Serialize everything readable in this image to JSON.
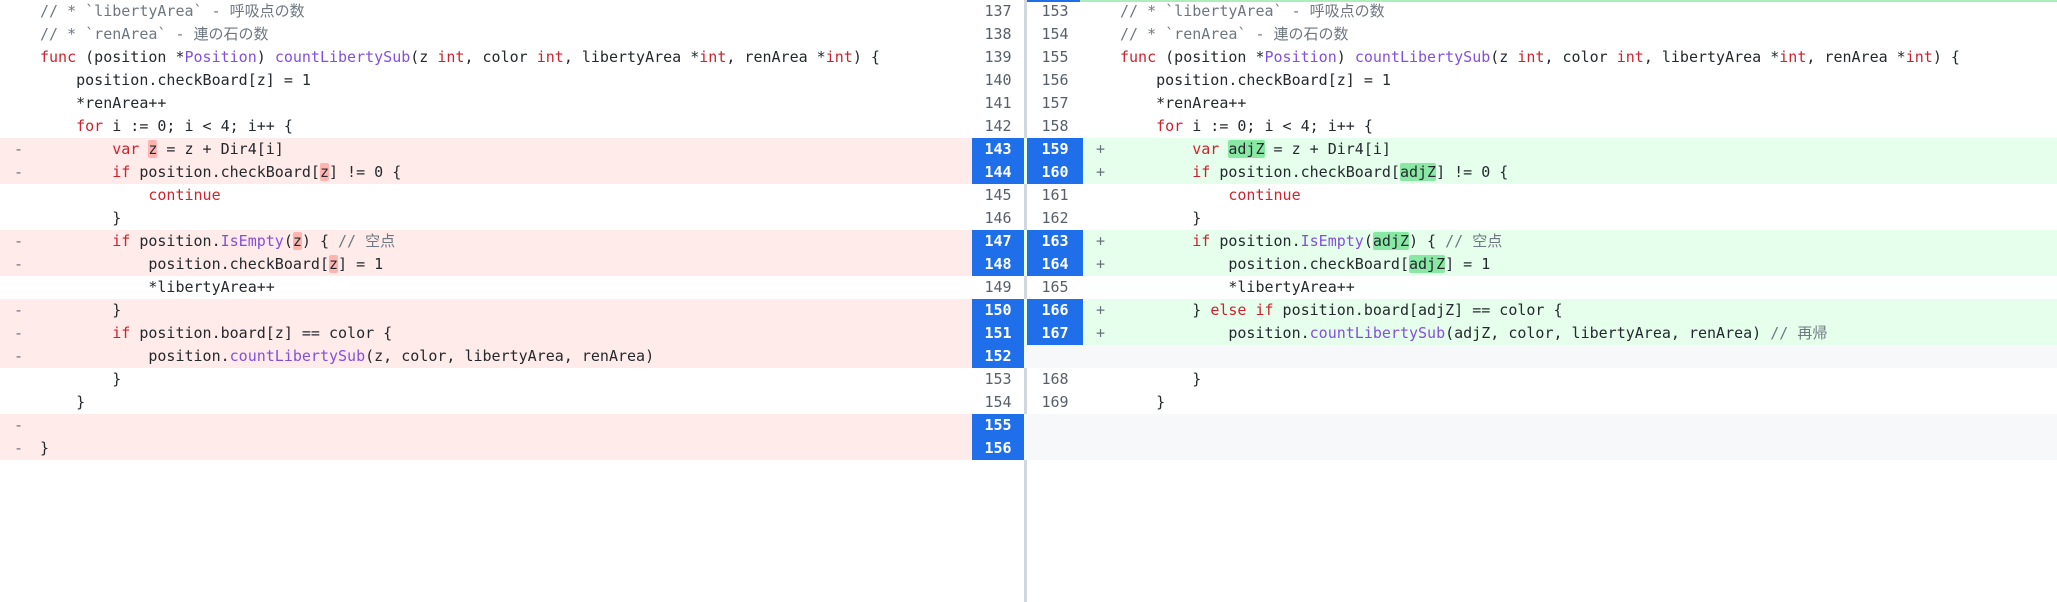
{
  "left": {
    "rows": [
      {
        "kind": "ctx",
        "num": "137",
        "sign": "",
        "indent": 0,
        "tokens": [
          [
            "cm",
            "// * `libertyArea` - 呼吸点の数"
          ]
        ]
      },
      {
        "kind": "ctx",
        "num": "138",
        "sign": "",
        "indent": 0,
        "tokens": [
          [
            "cm",
            "// * `renArea` - 連の石の数"
          ]
        ]
      },
      {
        "kind": "ctx",
        "num": "139",
        "sign": "",
        "indent": 0,
        "tokens": [
          [
            "kw",
            "func"
          ],
          [
            "",
            " (position *"
          ],
          [
            "fn",
            "Position"
          ],
          [
            "",
            ") "
          ],
          [
            "fn",
            "countLibertySub"
          ],
          [
            "",
            "(z "
          ],
          [
            "ty",
            "int"
          ],
          [
            "",
            ", color "
          ],
          [
            "ty",
            "int"
          ],
          [
            "",
            ", libertyArea *"
          ],
          [
            "ty",
            "int"
          ],
          [
            "",
            ", renArea *"
          ],
          [
            "ty",
            "int"
          ],
          [
            "",
            ") {"
          ]
        ]
      },
      {
        "kind": "ctx",
        "num": "140",
        "sign": "",
        "indent": 1,
        "tokens": [
          [
            "",
            "position.checkBoard[z] = 1"
          ]
        ]
      },
      {
        "kind": "ctx",
        "num": "141",
        "sign": "",
        "indent": 1,
        "tokens": [
          [
            "",
            "*renArea++"
          ]
        ]
      },
      {
        "kind": "ctx",
        "num": "142",
        "sign": "",
        "indent": 1,
        "tokens": [
          [
            "kw",
            "for"
          ],
          [
            "",
            " i := 0; i < 4; i++ {"
          ]
        ]
      },
      {
        "kind": "del",
        "num": "143",
        "sign": "-",
        "indent": 2,
        "tokens": [
          [
            "kw",
            "var"
          ],
          [
            "",
            " "
          ],
          [
            "hl-del",
            "z"
          ],
          [
            "",
            " = z + Dir4[i]"
          ]
        ]
      },
      {
        "kind": "del",
        "num": "144",
        "sign": "-",
        "indent": 2,
        "tokens": [
          [
            "kw",
            "if"
          ],
          [
            "",
            " position.checkBoard["
          ],
          [
            "hl-del",
            "z"
          ],
          [
            "",
            "] != 0 {"
          ]
        ]
      },
      {
        "kind": "ctx",
        "num": "145",
        "sign": "",
        "indent": 3,
        "tokens": [
          [
            "kw",
            "continue"
          ]
        ]
      },
      {
        "kind": "ctx",
        "num": "146",
        "sign": "",
        "indent": 2,
        "tokens": [
          [
            "",
            "}"
          ]
        ]
      },
      {
        "kind": "del",
        "num": "147",
        "sign": "-",
        "indent": 2,
        "tokens": [
          [
            "kw",
            "if"
          ],
          [
            "",
            " position."
          ],
          [
            "fn",
            "IsEmpty"
          ],
          [
            "",
            "("
          ],
          [
            "hl-del",
            "z"
          ],
          [
            "",
            ") { "
          ],
          [
            "cm",
            "// 空点"
          ]
        ]
      },
      {
        "kind": "del",
        "num": "148",
        "sign": "-",
        "indent": 3,
        "tokens": [
          [
            "",
            "position.checkBoard["
          ],
          [
            "hl-del",
            "z"
          ],
          [
            "",
            "] = 1"
          ]
        ]
      },
      {
        "kind": "ctx",
        "num": "149",
        "sign": "",
        "indent": 3,
        "tokens": [
          [
            "",
            "*libertyArea++"
          ]
        ]
      },
      {
        "kind": "del",
        "num": "150",
        "sign": "-",
        "indent": 2,
        "tokens": [
          [
            "",
            "}"
          ]
        ]
      },
      {
        "kind": "del",
        "num": "151",
        "sign": "-",
        "indent": 2,
        "tokens": [
          [
            "kw",
            "if"
          ],
          [
            "",
            " position.board[z] == color {"
          ]
        ]
      },
      {
        "kind": "del",
        "num": "152",
        "sign": "-",
        "indent": 3,
        "tokens": [
          [
            "",
            "position."
          ],
          [
            "fn",
            "countLibertySub"
          ],
          [
            "",
            "(z, color, libertyArea, renArea)"
          ]
        ]
      },
      {
        "kind": "ctx",
        "num": "153",
        "sign": "",
        "indent": 2,
        "tokens": [
          [
            "",
            "}"
          ]
        ]
      },
      {
        "kind": "ctx",
        "num": "154",
        "sign": "",
        "indent": 1,
        "tokens": [
          [
            "",
            "}"
          ]
        ]
      },
      {
        "kind": "del",
        "num": "155",
        "sign": "-",
        "indent": 0,
        "tokens": []
      },
      {
        "kind": "del",
        "num": "156",
        "sign": "-",
        "indent": 0,
        "tokens": [
          [
            "",
            "}"
          ]
        ]
      }
    ]
  },
  "right": {
    "rows": [
      {
        "kind": "ctx",
        "num": "153",
        "sign": "",
        "indent": 0,
        "tokens": [
          [
            "cm",
            "// * `libertyArea` - 呼吸点の数"
          ]
        ]
      },
      {
        "kind": "ctx",
        "num": "154",
        "sign": "",
        "indent": 0,
        "tokens": [
          [
            "cm",
            "// * `renArea` - 連の石の数"
          ]
        ]
      },
      {
        "kind": "ctx",
        "num": "155",
        "sign": "",
        "indent": 0,
        "tokens": [
          [
            "kw",
            "func"
          ],
          [
            "",
            " (position *"
          ],
          [
            "fn",
            "Position"
          ],
          [
            "",
            ") "
          ],
          [
            "fn",
            "countLibertySub"
          ],
          [
            "",
            "(z "
          ],
          [
            "ty",
            "int"
          ],
          [
            "",
            ", color "
          ],
          [
            "ty",
            "int"
          ],
          [
            "",
            ", libertyArea *"
          ],
          [
            "ty",
            "int"
          ],
          [
            "",
            ", renArea *"
          ],
          [
            "ty",
            "int"
          ],
          [
            "",
            ") {"
          ]
        ]
      },
      {
        "kind": "ctx",
        "num": "156",
        "sign": "",
        "indent": 1,
        "tokens": [
          [
            "",
            "position.checkBoard[z] = 1"
          ]
        ]
      },
      {
        "kind": "ctx",
        "num": "157",
        "sign": "",
        "indent": 1,
        "tokens": [
          [
            "",
            "*renArea++"
          ]
        ]
      },
      {
        "kind": "ctx",
        "num": "158",
        "sign": "",
        "indent": 1,
        "tokens": [
          [
            "kw",
            "for"
          ],
          [
            "",
            " i := 0; i < 4; i++ {"
          ]
        ]
      },
      {
        "kind": "add",
        "num": "159",
        "sign": "+",
        "indent": 2,
        "tokens": [
          [
            "kw",
            "var"
          ],
          [
            "",
            " "
          ],
          [
            "hl-add",
            "adjZ"
          ],
          [
            "",
            " = z + Dir4[i]"
          ]
        ]
      },
      {
        "kind": "add",
        "num": "160",
        "sign": "+",
        "indent": 2,
        "tokens": [
          [
            "kw",
            "if"
          ],
          [
            "",
            " position.checkBoard["
          ],
          [
            "hl-add",
            "adjZ"
          ],
          [
            "",
            "] != 0 {"
          ]
        ]
      },
      {
        "kind": "ctx",
        "num": "161",
        "sign": "",
        "indent": 3,
        "tokens": [
          [
            "kw",
            "continue"
          ]
        ]
      },
      {
        "kind": "ctx",
        "num": "162",
        "sign": "",
        "indent": 2,
        "tokens": [
          [
            "",
            "}"
          ]
        ]
      },
      {
        "kind": "add",
        "num": "163",
        "sign": "+",
        "indent": 2,
        "tokens": [
          [
            "kw",
            "if"
          ],
          [
            "",
            " position."
          ],
          [
            "fn",
            "IsEmpty"
          ],
          [
            "",
            "("
          ],
          [
            "hl-add",
            "adjZ"
          ],
          [
            "",
            ") { "
          ],
          [
            "cm",
            "// 空点"
          ]
        ]
      },
      {
        "kind": "add",
        "num": "164",
        "sign": "+",
        "indent": 3,
        "tokens": [
          [
            "",
            "position.checkBoard["
          ],
          [
            "hl-add",
            "adjZ"
          ],
          [
            "",
            "] = 1"
          ]
        ]
      },
      {
        "kind": "ctx",
        "num": "165",
        "sign": "",
        "indent": 3,
        "tokens": [
          [
            "",
            "*libertyArea++"
          ]
        ]
      },
      {
        "kind": "add",
        "num": "166",
        "sign": "+",
        "indent": 2,
        "tokens": [
          [
            "",
            "} "
          ],
          [
            "kw",
            "else if"
          ],
          [
            "",
            " position.board[adjZ] == color {"
          ]
        ]
      },
      {
        "kind": "add",
        "num": "167",
        "sign": "+",
        "indent": 3,
        "tokens": [
          [
            "",
            "position."
          ],
          [
            "fn",
            "countLibertySub"
          ],
          [
            "",
            "(adjZ, color, libertyArea, renArea) "
          ],
          [
            "cm",
            "// 再帰"
          ]
        ]
      },
      {
        "kind": "empty",
        "num": "",
        "sign": "",
        "indent": 0,
        "tokens": []
      },
      {
        "kind": "ctx",
        "num": "168",
        "sign": "",
        "indent": 2,
        "tokens": [
          [
            "",
            "}"
          ]
        ]
      },
      {
        "kind": "ctx",
        "num": "169",
        "sign": "",
        "indent": 1,
        "tokens": [
          [
            "",
            "}"
          ]
        ]
      },
      {
        "kind": "empty",
        "num": "",
        "sign": "",
        "indent": 0,
        "tokens": []
      },
      {
        "kind": "empty",
        "num": "",
        "sign": "",
        "indent": 0,
        "tokens": []
      }
    ]
  },
  "colors": {
    "deletion_bg": "#ffebe9",
    "addition_bg": "#e6ffec",
    "changed_line_number_bg": "#1f6feb",
    "keyword": "#cf222e",
    "function": "#8250df"
  }
}
